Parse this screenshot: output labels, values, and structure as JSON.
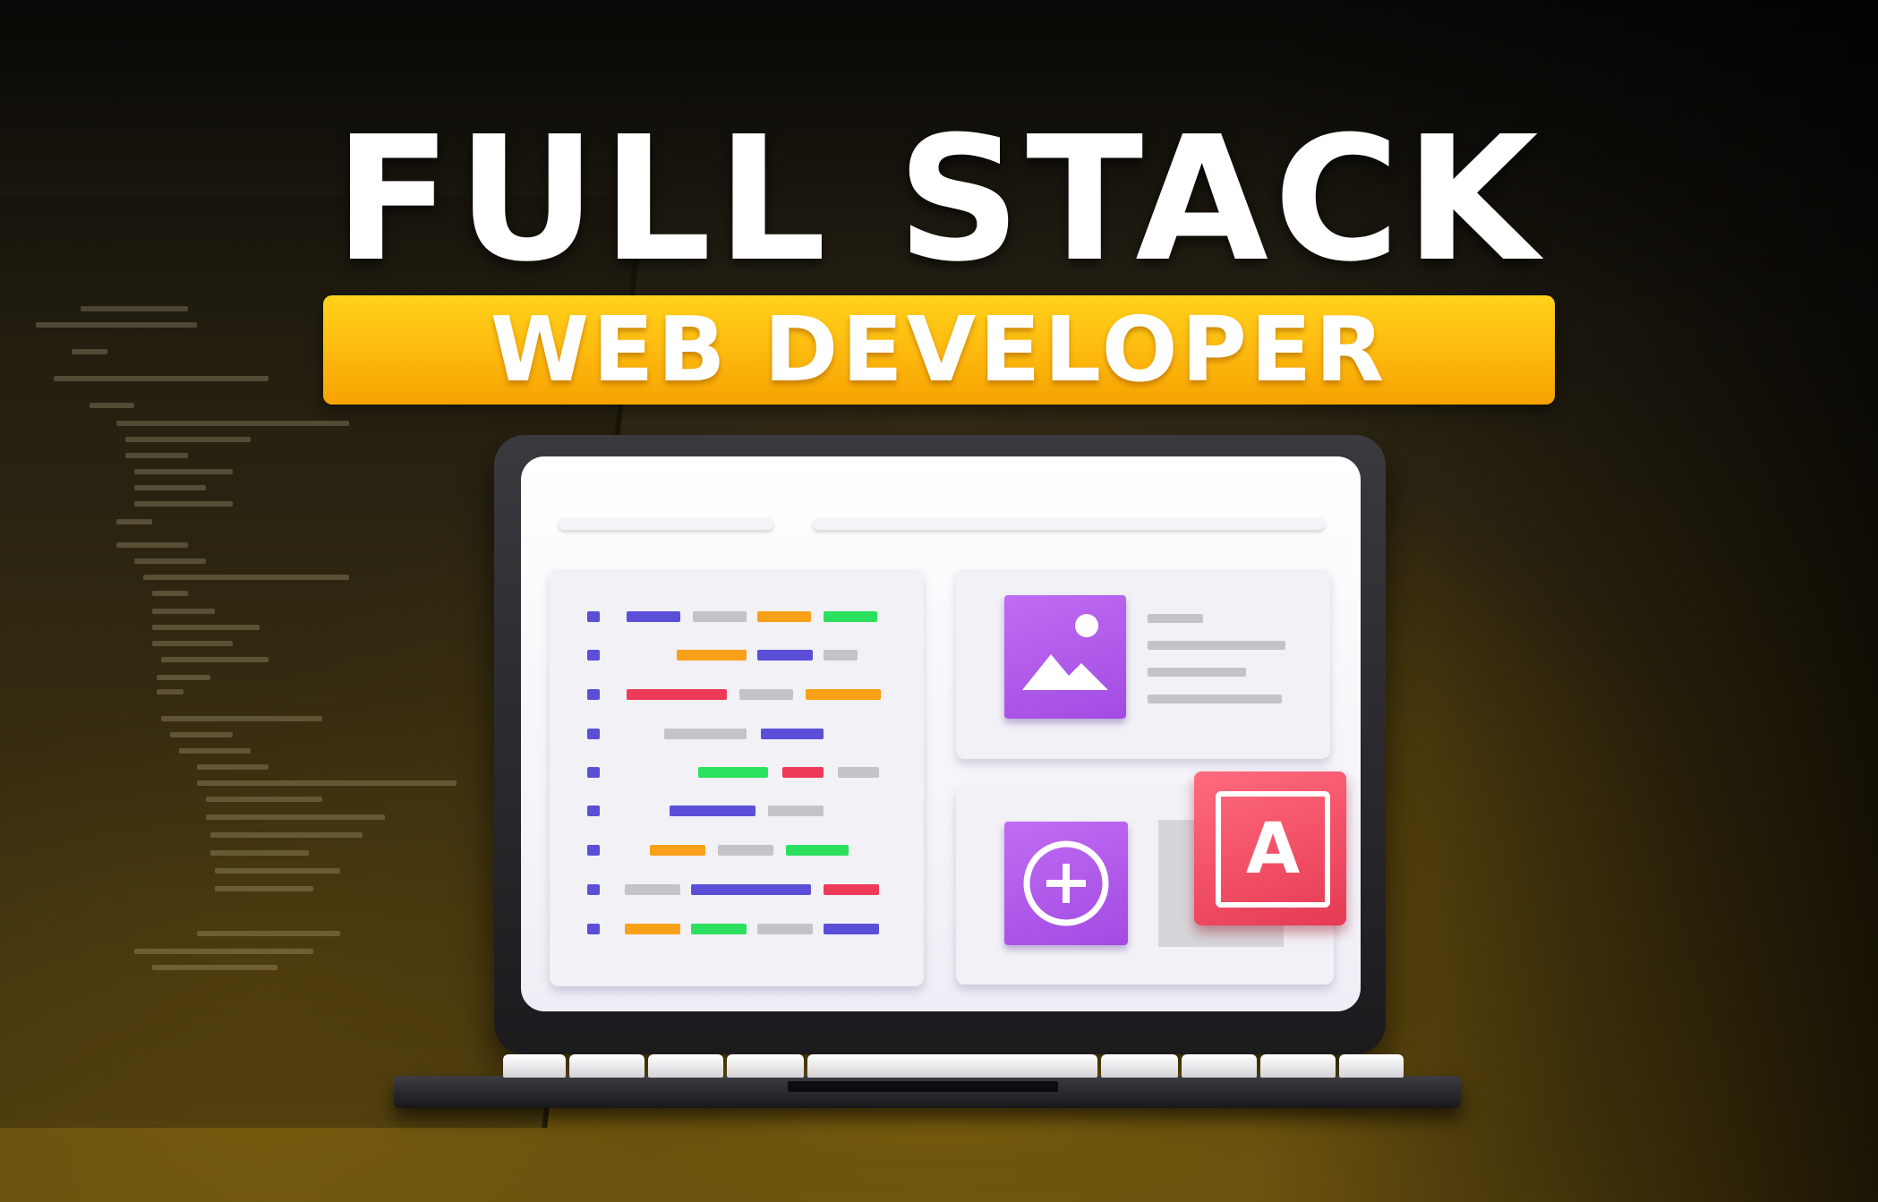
{
  "header": {
    "title": "FULL STACK",
    "subtitle": "WEB DEVELOPER"
  },
  "card": {
    "letter": "A"
  },
  "colors": {
    "banner": "#fdb80f",
    "tile_purple": "#b35ce9",
    "tile_red": "#f04d64",
    "code_blue": "#5b4fd8",
    "code_grey": "#c4c4c8",
    "code_orange": "#f9a019",
    "code_green": "#2be05e",
    "code_red": "#ee3a57"
  },
  "icons": [
    "image-icon",
    "plus-circle-icon",
    "letter-a-icon",
    "laptop-icon"
  ]
}
